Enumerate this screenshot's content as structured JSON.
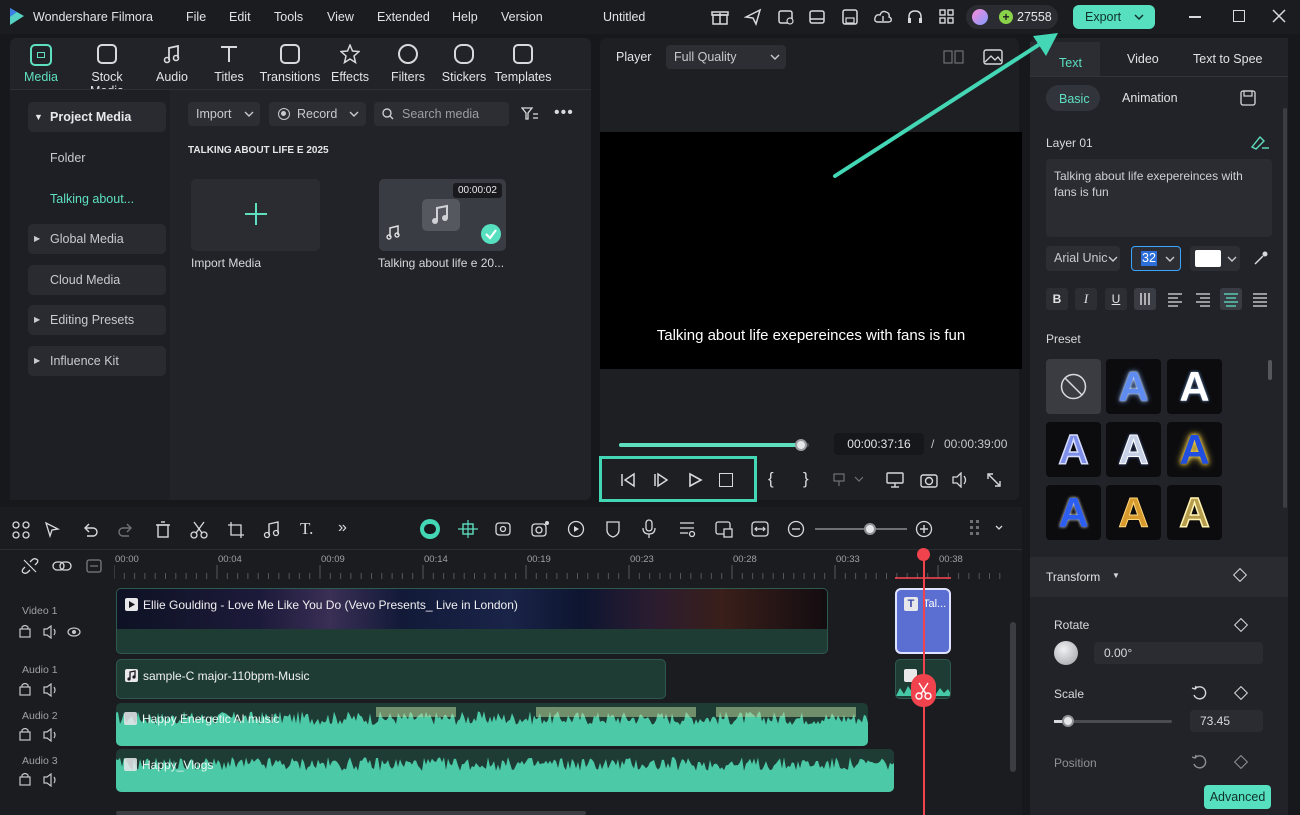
{
  "app": {
    "name": "Wondershare Filmora",
    "project_title": "Untitled",
    "credits": "27558",
    "export_label": "Export"
  },
  "menu": [
    "File",
    "Edit",
    "Tools",
    "View",
    "Extended",
    "Help",
    "Version"
  ],
  "media_tabs": [
    {
      "label": "Media",
      "icon": "media-icon"
    },
    {
      "label": "Stock Media",
      "icon": "stock-media-icon"
    },
    {
      "label": "Audio",
      "icon": "audio-icon"
    },
    {
      "label": "Titles",
      "icon": "titles-icon"
    },
    {
      "label": "Transitions",
      "icon": "transitions-icon"
    },
    {
      "label": "Effects",
      "icon": "effects-icon"
    },
    {
      "label": "Filters",
      "icon": "filters-icon"
    },
    {
      "label": "Stickers",
      "icon": "stickers-icon"
    },
    {
      "label": "Templates",
      "icon": "templates-icon"
    }
  ],
  "sidebar": {
    "items": [
      {
        "label": "Project Media"
      },
      {
        "label": "Folder"
      },
      {
        "label": "Talking about..."
      },
      {
        "label": "Global Media"
      },
      {
        "label": "Cloud Media"
      },
      {
        "label": "Editing Presets"
      },
      {
        "label": "Influence Kit"
      }
    ]
  },
  "media_toolbar": {
    "import_label": "Import",
    "record_label": "Record",
    "search_placeholder": "Search media"
  },
  "media_folder": {
    "title": "TALKING ABOUT LIFE E 2025"
  },
  "media_items": [
    {
      "label": "Import Media"
    },
    {
      "label": "Talking about life e 20...",
      "duration": "00:00:02"
    }
  ],
  "player": {
    "label": "Player",
    "quality": "Full Quality",
    "caption": "Talking about life exepereinces with fans is fun",
    "current_time": "00:00:37:16",
    "separator": "/",
    "total_time": "00:00:39:00",
    "progress": 0.96
  },
  "timeline": {
    "ruler": [
      "00:00",
      "00:04",
      "00:09",
      "00:14",
      "00:19",
      "00:23",
      "00:28",
      "00:33",
      "00:38"
    ],
    "zoom": 0.6,
    "tracks": [
      {
        "name": "Video 1"
      },
      {
        "name": "Audio 1"
      },
      {
        "name": "Audio 2"
      },
      {
        "name": "Audio 3"
      }
    ],
    "clips": {
      "video": "Ellie Goulding - Love Me Like You Do (Vevo Presents_ Live in London)",
      "title_clip": "Tal...",
      "audio1": "sample-C major-110bpm-Music",
      "audio2": "Happy Energetic AI music",
      "audio3": "Happy_Vlogs"
    }
  },
  "right_panel": {
    "tabs": [
      "Text",
      "Video",
      "Text to Spee"
    ],
    "subtabs": [
      "Basic",
      "Animation"
    ],
    "layer_name": "Layer 01",
    "text_value": "Talking about life exepereinces with fans is fun",
    "font": "Arial Unic",
    "font_size": "32",
    "text_color": "#ffffff",
    "preset_label": "Preset",
    "transform_label": "Transform",
    "rotate_label": "Rotate",
    "rotate_value": "0.00°",
    "scale_label": "Scale",
    "scale_value": "73.45",
    "scale_level": 0.12,
    "position_label": "Position",
    "advanced_label": "Advanced"
  },
  "colors": {
    "accent": "#5ee0c0",
    "highlight": "#43d7b5",
    "playhead": "#f0434d",
    "title_clip": "#5b6fd3"
  }
}
